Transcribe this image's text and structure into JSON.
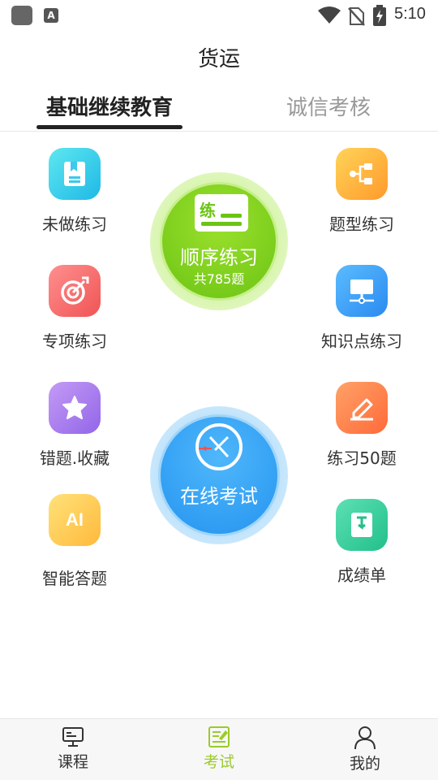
{
  "statusbar": {
    "time": "5:10",
    "a_label": "A"
  },
  "page": {
    "title": "货运"
  },
  "tabs": [
    {
      "label": "基础继续教育",
      "active": true
    },
    {
      "label": "诚信考核",
      "active": false
    }
  ],
  "features": {
    "undone": "未做练习",
    "question_type": "题型练习",
    "special": "专项练习",
    "knowledge": "知识点练习",
    "wrong_fav": "错题.收藏",
    "practice50": "练习50题",
    "ai_answer": "智能答题",
    "ai_badge": "AI",
    "report": "成绩单"
  },
  "sequential": {
    "icon_char": "练",
    "title": "顺序练习",
    "count": "共785题"
  },
  "exam": {
    "title": "在线考试"
  },
  "bottom_nav": [
    {
      "label": "课程",
      "icon": "monitor-icon"
    },
    {
      "label": "考试",
      "icon": "exam-paper-icon"
    },
    {
      "label": "我的",
      "icon": "person-icon"
    }
  ],
  "colors": {
    "accent_green": "#9acb2a",
    "exam_blue": "#2594f0",
    "practice_green": "#6cc414"
  }
}
